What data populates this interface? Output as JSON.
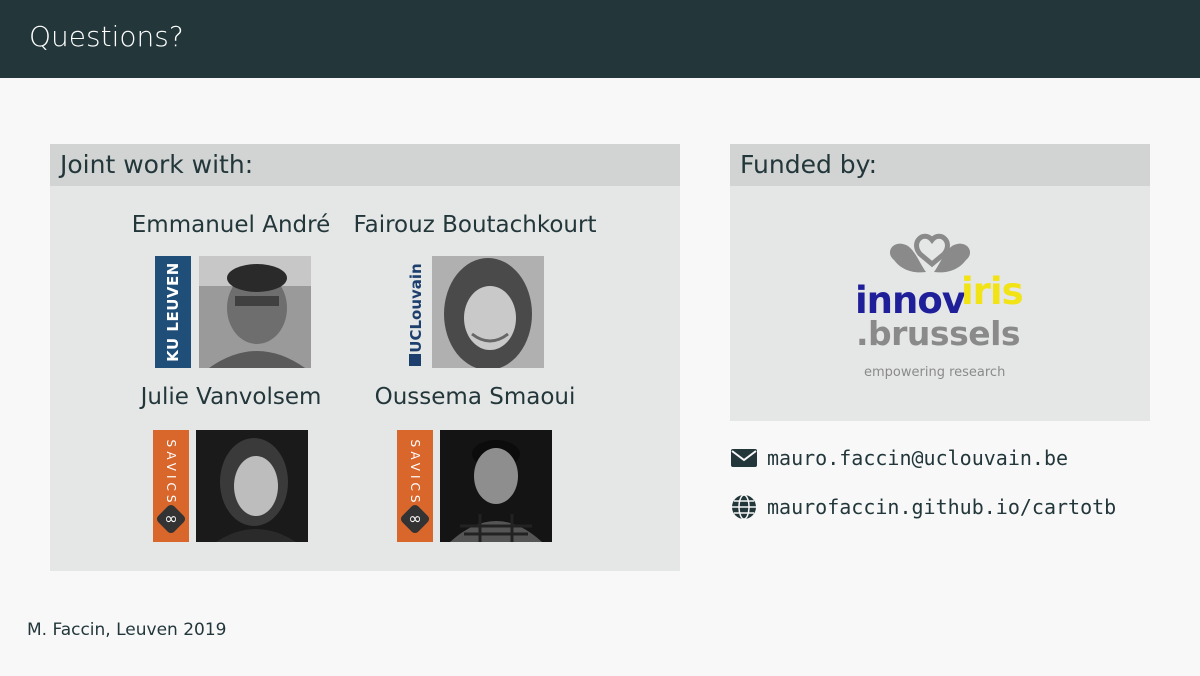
{
  "slide": {
    "title": "Questions?",
    "footer": "M. Faccin, Leuven 2019"
  },
  "joint": {
    "heading": "Joint work with:",
    "people": [
      {
        "name": "Emmanuel André",
        "logo_text": "KU LEUVEN"
      },
      {
        "name": "Fairouz Boutachkourt",
        "logo_text": "UCLouvain"
      },
      {
        "name": "Julie Vanvolsem",
        "logo_text": "SAVICS"
      },
      {
        "name": "Oussema Smaoui",
        "logo_text": "SAVICS"
      }
    ]
  },
  "funded": {
    "heading": "Funded by:",
    "logo_innov": "innov",
    "logo_iris": "iris",
    "logo_brussels": ".brussels",
    "logo_tagline": "empowering research"
  },
  "contact": {
    "email": "mauro.faccin@uclouvain.be",
    "email_icon": "envelope-icon",
    "website": "maurofaccin.github.io/cartotb",
    "website_icon": "globe-icon"
  },
  "colors": {
    "header_bg": "#23373b",
    "block_head_bg": "#d1d4d3",
    "block_body_bg": "#e5e7e6",
    "ku_leuven_blue": "#1f4e79",
    "savics_orange": "#d9662b",
    "innov_blue": "#1f1f9a",
    "iris_yellow": "#f2e317"
  }
}
